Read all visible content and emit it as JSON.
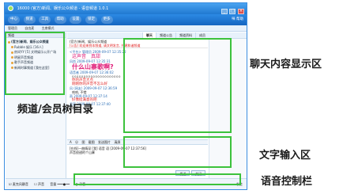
{
  "window": {
    "title": "16000 (官方)新闻、娱乐公众频道 - 语音频道 1.0.1",
    "controls": [
      "_",
      "□",
      "×"
    ]
  },
  "toolbar": {
    "items": [
      "中心",
      "频道",
      "工具",
      "帮助",
      "设置",
      "锁定",
      "更多"
    ],
    "right_text": "咪 帮助"
  },
  "subbar": {
    "items": [
      "管理员",
      "自由麦",
      "主席模式"
    ]
  },
  "left": {
    "header": "频道",
    "tree": [
      {
        "text": "(官方)新闻、娱乐公众频道",
        "level": 0
      },
      {
        "text": "Rubble 娱乐 [16人]",
        "level": 1
      },
      {
        "text": "房间YY [5] 文明娱乐公开广场",
        "level": 1
      },
      {
        "text": "明星声音频道",
        "level": 1
      },
      {
        "text": "歌手声音频道",
        "level": 1
      },
      {
        "text": "新闻时事频道 [我在这里]",
        "level": 1
      }
    ]
  },
  "tabs": [
    "聊天",
    "频道公告",
    "频道资料",
    "成员"
  ],
  "announce": {
    "line1": "(官方)新闻、娱乐公众频道",
    "line2": "[公告] 欢迎来到本频道, 请文明发言, 共建和谐频道"
  },
  "messages": [
    {
      "meta": "<平台> 管理员 2009-09-07 12:35:22",
      "lines": [
        "这声音　真甜"
      ],
      "style": "mid"
    },
    {
      "meta": "风尚 2009-09-07 12:35:31",
      "lines": [
        "什么山寨歌啊?"
      ],
      "style": "big"
    },
    {
      "meta": "语音者 2009-09-07 12:36:02",
      "lines": [
        "ooooooooooooooooooooo",
        "你的声音大点",
        "刚刚你的声音不怎么好"
      ],
      "style": "mixed"
    },
    {
      "meta": "风 (网友) 2009-09-07 12:36:59",
      "lines": [
        "哈哈, 不错"
      ],
      "style": "plain"
    },
    {
      "meta": "雨 2009-09-07 12:37:14",
      "lines": [
        "好像挺满意的吧"
      ],
      "style": "small-red"
    },
    {
      "meta": "月亮 2009-09-07 12:37:40",
      "lines": [
        "嗯嗯"
      ],
      "style": "plain"
    }
  ],
  "inputbar": {
    "items": [
      "A",
      "☺",
      "图",
      "截图",
      "发送图片",
      "清屏"
    ]
  },
  "inputbox": {
    "line1": "[在线]一曲情深 [我] 语音 语 [2009-09-07 12:37:56]",
    "line2": "声音很甜的个山寨"
  },
  "sendbar": {
    "send": "发送",
    "close": "关闭"
  },
  "voicebar": {
    "items": [
      "☑ 麦克风静音",
      "☐ 声音",
      "音量 ━━━●━━",
      "● 录音"
    ],
    "right": "发言"
  },
  "annotations": {
    "tree": "频道/会员树目录",
    "chat": "聊天内容显示区",
    "input": "文字输入区",
    "voice": "语音控制栏"
  },
  "colors": {
    "annotation_box": "#3cc23c",
    "titlebar": "#1f78d1",
    "highlight_text": "#e0207a"
  }
}
